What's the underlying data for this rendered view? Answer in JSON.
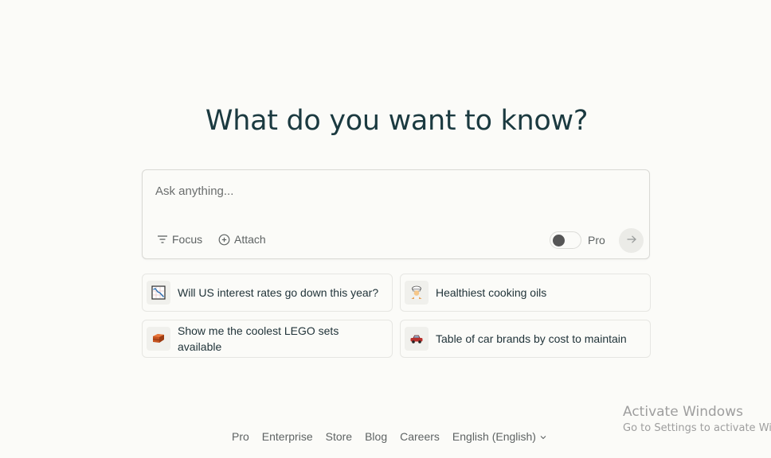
{
  "headline": "What do you want to know?",
  "ask_box": {
    "placeholder": "Ask anything...",
    "value": "",
    "focus_label": "Focus",
    "attach_label": "Attach",
    "pro_label": "Pro",
    "pro_enabled": false,
    "submit_icon": "arrow-right-icon"
  },
  "suggestions": [
    {
      "icon": "chart-decreasing-icon",
      "label": "Will US interest rates go down this year?"
    },
    {
      "icon": "cook-emoji-icon",
      "label": "Healthiest cooking oils"
    },
    {
      "icon": "brick-emoji-icon",
      "label": "Show me the coolest LEGO sets available"
    },
    {
      "icon": "car-emoji-icon",
      "label": "Table of car brands by cost to maintain"
    }
  ],
  "footer": {
    "links": [
      "Pro",
      "Enterprise",
      "Store",
      "Blog",
      "Careers"
    ],
    "language": "English (English)"
  },
  "watermark": {
    "title": "Activate Windows",
    "subtitle": "Go to Settings to activate Windows."
  },
  "colors": {
    "background": "#fbfbf8",
    "headline": "#1b3a40",
    "muted_text": "#5e6363",
    "border": "#d9d9d5"
  }
}
